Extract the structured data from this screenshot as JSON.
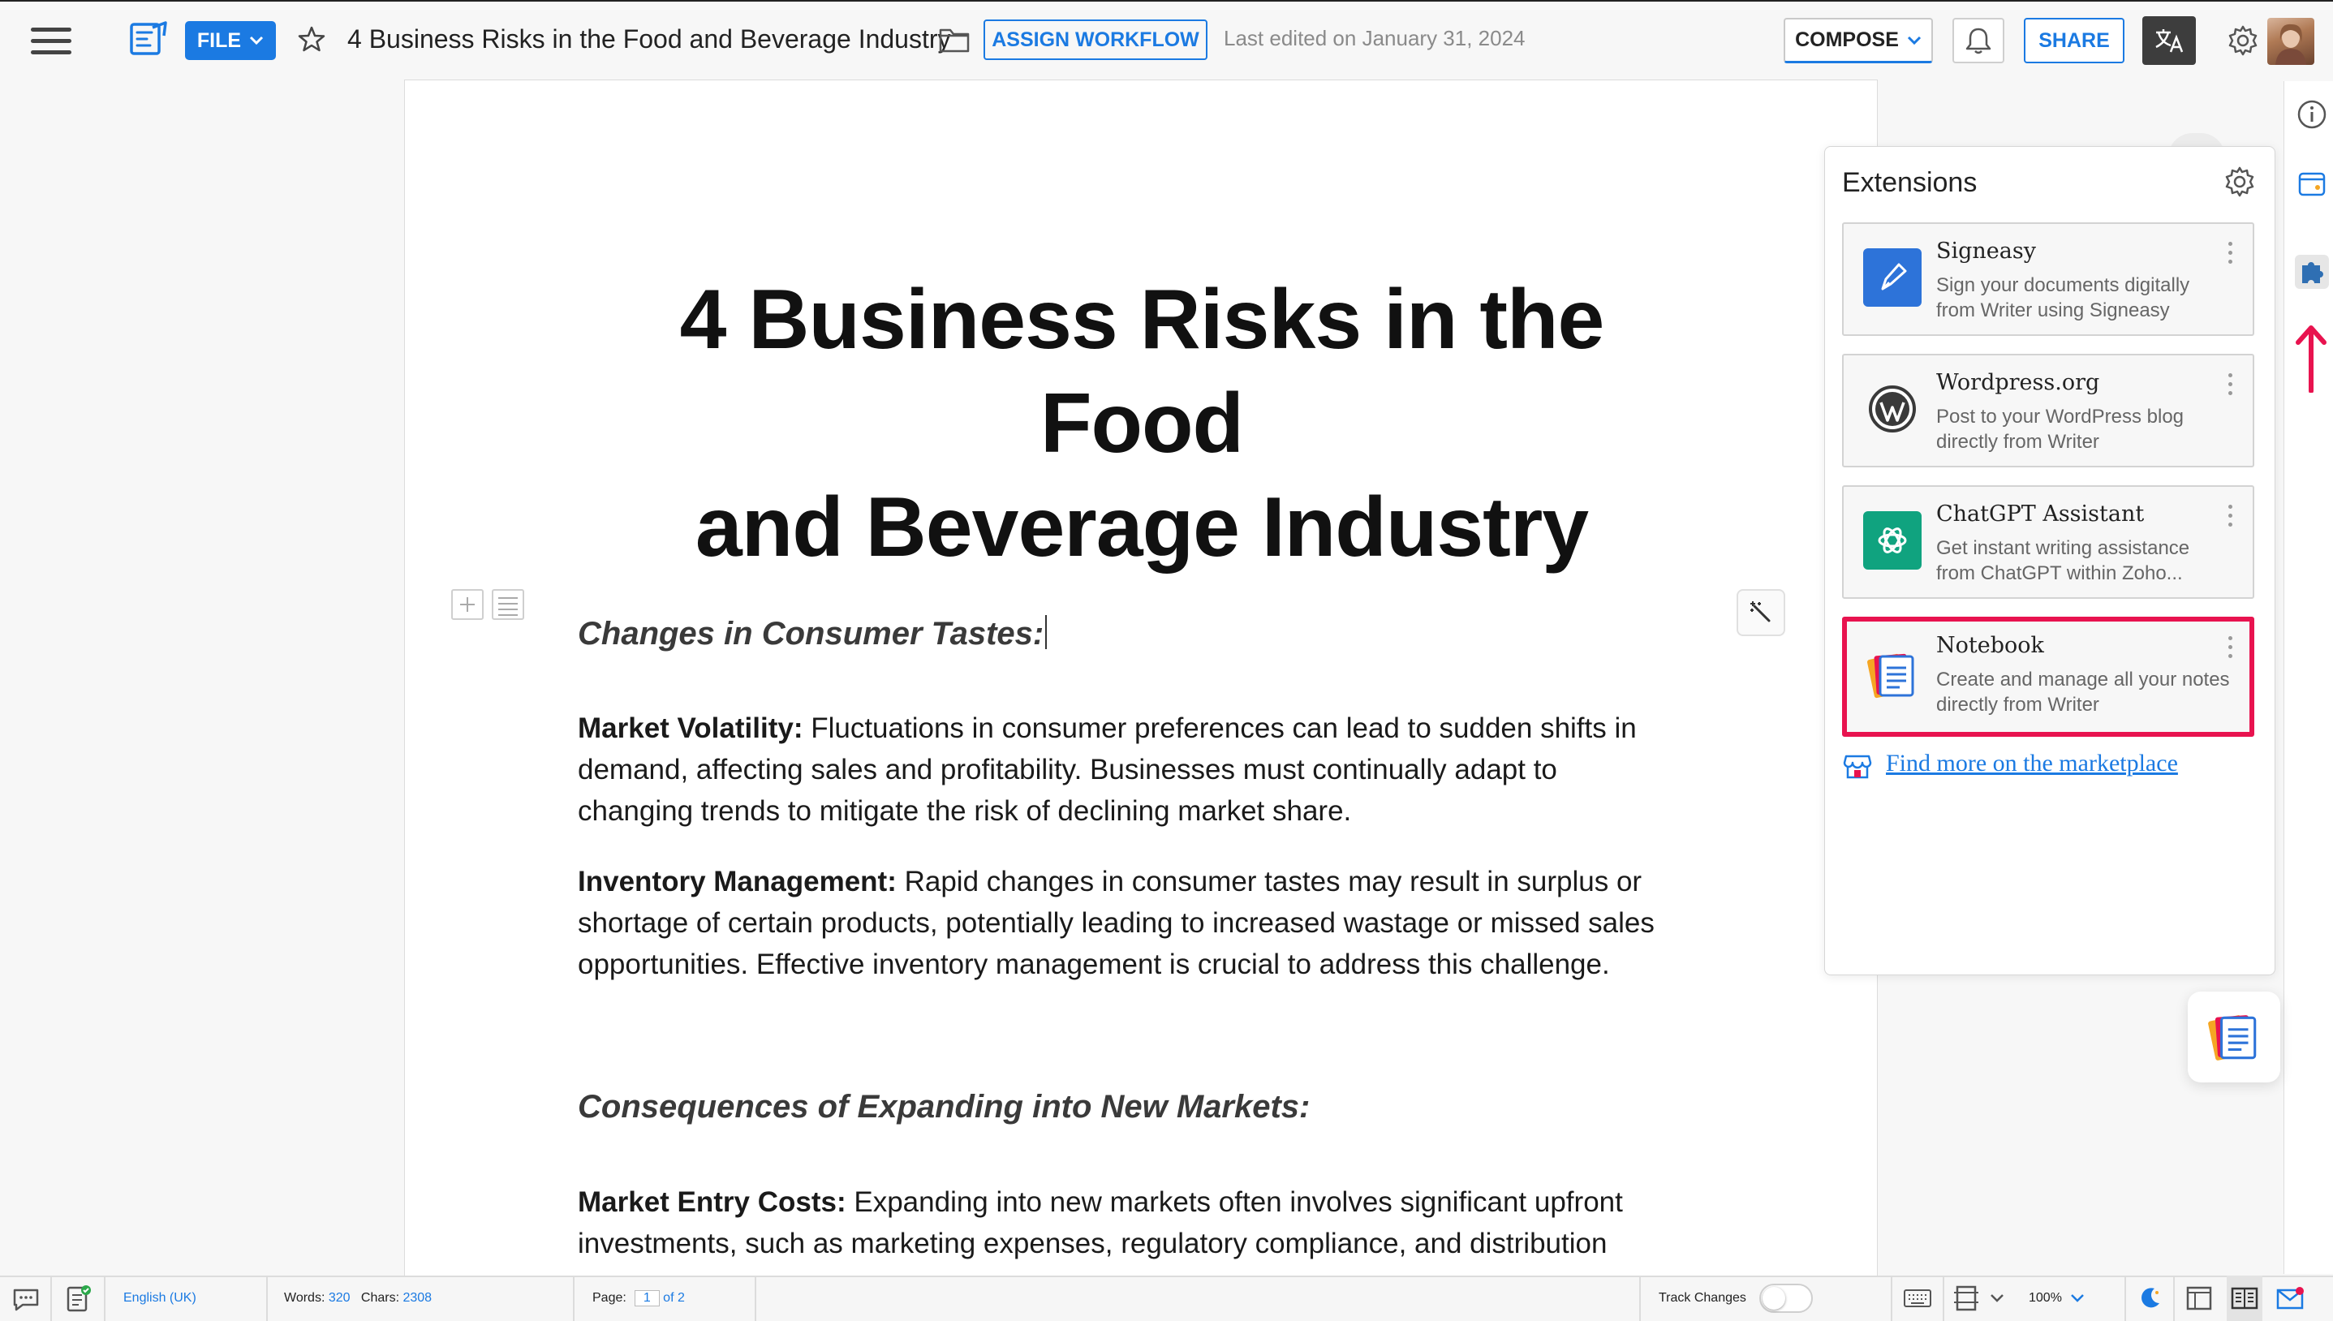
{
  "toolbar": {
    "file_label": "FILE",
    "doc_title": "4 Business Risks in the Food and Beverage Industry",
    "assign_workflow_label": "ASSIGN WORKFLOW",
    "last_edited": "Last edited on January 31, 2024",
    "compose_label": "COMPOSE",
    "share_label": "SHARE",
    "icons": [
      "hamburger-menu-icon",
      "writer-doc-icon",
      "star-icon",
      "folder-icon",
      "bell-icon",
      "translate-icon",
      "gear-icon"
    ]
  },
  "document": {
    "heading_lines": [
      "4 Business Risks in the Food",
      "and Beverage Industry"
    ],
    "section1_title": "Changes in Consumer Tastes:",
    "p1": {
      "bold": "Market Volatility:",
      "lines": [
        " Fluctuations in consumer preferences can lead to sudden shifts in",
        "demand, affecting sales and profitability. Businesses must continually adapt to",
        "changing trends to mitigate the risk of declining market share."
      ]
    },
    "p2": {
      "bold": "Inventory Management:",
      "lines": [
        " Rapid changes in consumer tastes may result in surplus or",
        "shortage of certain products, potentially leading to increased wastage or missed sales",
        "opportunities. Effective inventory management is crucial to address this challenge."
      ]
    },
    "section2_title": "Consequences of Expanding into New Markets:",
    "p3": {
      "bold": "Market Entry Costs:",
      "lines": [
        " Expanding into new markets often involves significant upfront",
        "investments, such as marketing expenses, regulatory compliance, and distribution"
      ]
    }
  },
  "extensions": {
    "title": "Extensions",
    "items": [
      {
        "name": "Signeasy",
        "desc": [
          "Sign your documents digitally",
          "from Writer using Signeasy"
        ],
        "icon": "signeasy-pen-icon",
        "color": "#2d73d9"
      },
      {
        "name": "Wordpress.org",
        "desc": [
          "Post to your WordPress blog",
          "directly from Writer"
        ],
        "icon": "wordpress-icon",
        "color": "#3a3a3a"
      },
      {
        "name": "ChatGPT Assistant",
        "desc": [
          "Get instant writing assistance",
          "from ChatGPT within Zoho..."
        ],
        "icon": "chatgpt-icon",
        "color": "#10a37f"
      },
      {
        "name": "Notebook",
        "desc": [
          "Create and manage all your notes",
          "directly from Writer"
        ],
        "icon": "notebook-icon",
        "color": "#e8134f"
      }
    ],
    "marketplace_link": "Find more on the marketplace"
  },
  "statusbar": {
    "language": "English (UK)",
    "words_label": "Words:",
    "words": "320",
    "chars_label": "Chars:",
    "chars": "2308",
    "page_label": "Page:",
    "page_current": "1",
    "page_of": "of 2",
    "track_changes": "Track Changes",
    "zoom": "100%"
  },
  "colors": {
    "accent": "#1b7ae2",
    "highlight": "#e8134f",
    "chatgpt": "#10a37f"
  }
}
